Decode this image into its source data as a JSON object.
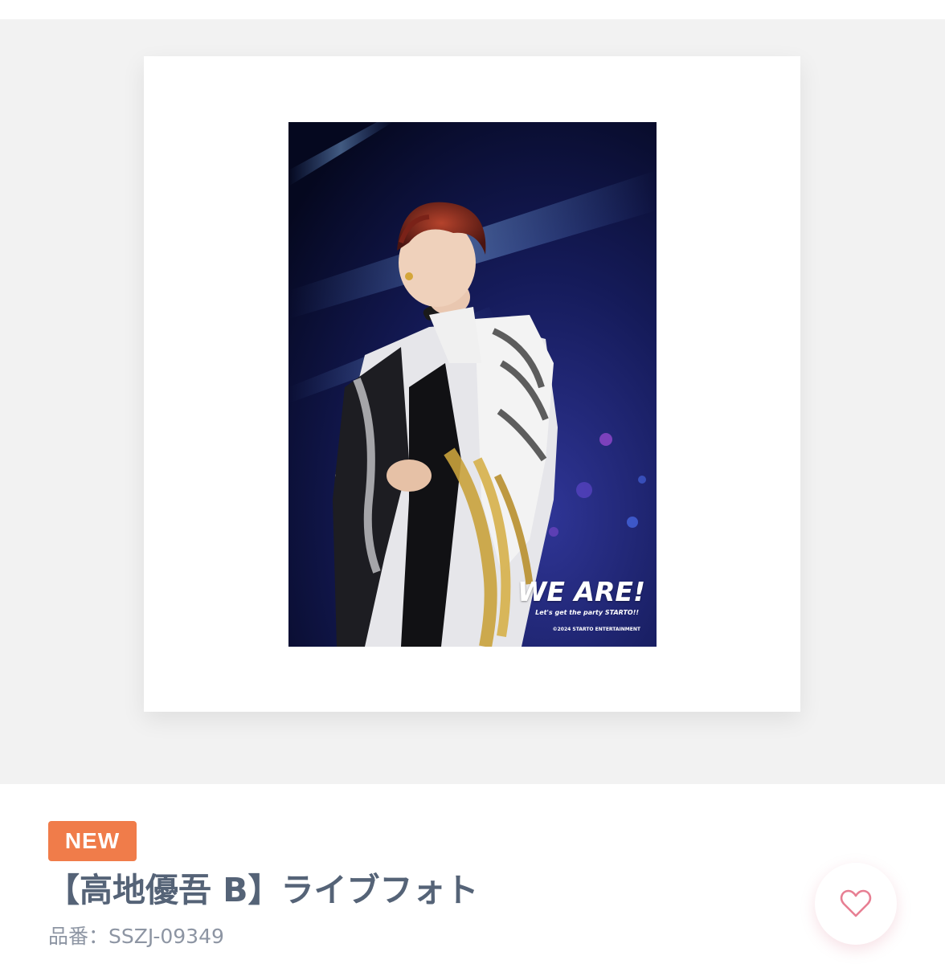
{
  "product": {
    "badge": "NEW",
    "title": "【高地優吾 B】ライブフォト",
    "sku_label": "品番：SSZJ-09349"
  },
  "photo": {
    "logo_text": "WE ARE!",
    "logo_subtitle": "Let's get the party STARTO!!",
    "copyright": "©2024 STARTO ENTERTAINMENT"
  },
  "favorite": {
    "icon": "heart-outline-icon"
  },
  "colors": {
    "badge": "#f07c4a",
    "title": "#556377",
    "sku": "#8d95a3",
    "heart": "#e77f93",
    "gallery_bg": "#f2f2f2"
  }
}
